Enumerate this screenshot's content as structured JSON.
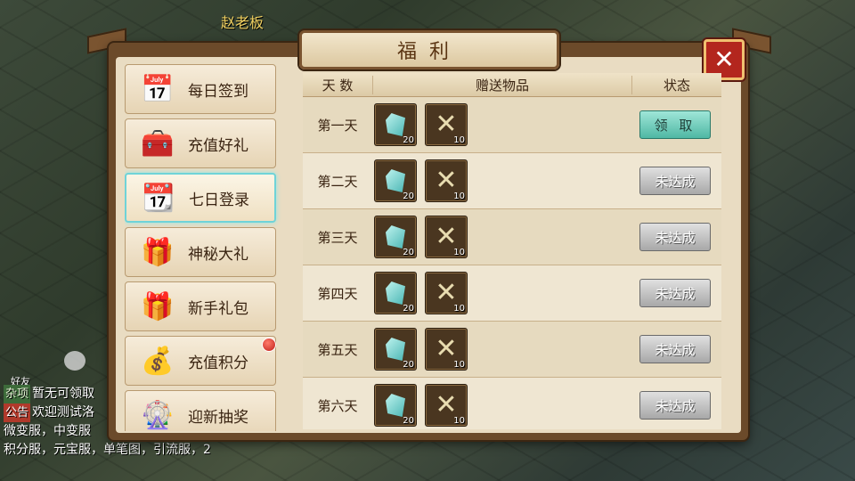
{
  "scene": {
    "npc_name": "赵老板",
    "hero_label": "好友",
    "chat": [
      {
        "tag": "杂项",
        "text": "暂无可领取"
      },
      {
        "tag": "公告",
        "text": "欢迎测试洛"
      },
      {
        "tag": "",
        "text": "微变服，中变服"
      },
      {
        "tag": "",
        "text": "积分服，元宝服，单笔图，引流服，2"
      }
    ]
  },
  "dialog": {
    "title": "福利",
    "menu": [
      {
        "label": "每日签到",
        "icon": "calendar-check-icon",
        "glyph": "📅",
        "active": false,
        "badge": false
      },
      {
        "label": "充值好礼",
        "icon": "treasure-chest-icon",
        "glyph": "🧰",
        "active": false,
        "badge": false
      },
      {
        "label": "七日登录",
        "icon": "calendar-seven-icon",
        "glyph": "📆",
        "active": true,
        "badge": false
      },
      {
        "label": "神秘大礼",
        "icon": "open-chest-icon",
        "glyph": "🎁",
        "active": false,
        "badge": false
      },
      {
        "label": "新手礼包",
        "icon": "gift-box-icon",
        "glyph": "🎁",
        "active": false,
        "badge": false
      },
      {
        "label": "充值积分",
        "icon": "gold-coins-icon",
        "glyph": "💰",
        "active": false,
        "badge": true
      },
      {
        "label": "迎新抽奖",
        "icon": "lottery-wheel-icon",
        "glyph": "🎡",
        "active": false,
        "badge": false
      }
    ],
    "table": {
      "headers": {
        "day": "天 数",
        "gifts": "赠送物品",
        "status": "状态"
      },
      "rows": [
        {
          "day": "第一天",
          "item1_qty": "20",
          "item2_qty": "10",
          "status": "领 取",
          "claimable": true
        },
        {
          "day": "第二天",
          "item1_qty": "20",
          "item2_qty": "10",
          "status": "未达成",
          "claimable": false
        },
        {
          "day": "第三天",
          "item1_qty": "20",
          "item2_qty": "10",
          "status": "未达成",
          "claimable": false
        },
        {
          "day": "第四天",
          "item1_qty": "20",
          "item2_qty": "10",
          "status": "未达成",
          "claimable": false
        },
        {
          "day": "第五天",
          "item1_qty": "20",
          "item2_qty": "10",
          "status": "未达成",
          "claimable": false
        },
        {
          "day": "第六天",
          "item1_qty": "20",
          "item2_qty": "10",
          "status": "未达成",
          "claimable": false
        }
      ]
    }
  },
  "colors": {
    "claim": "#4fb8a4",
    "locked": "#a8a8a8",
    "panel": "#6b4a2a",
    "active_glow": "#6fd3d8"
  }
}
